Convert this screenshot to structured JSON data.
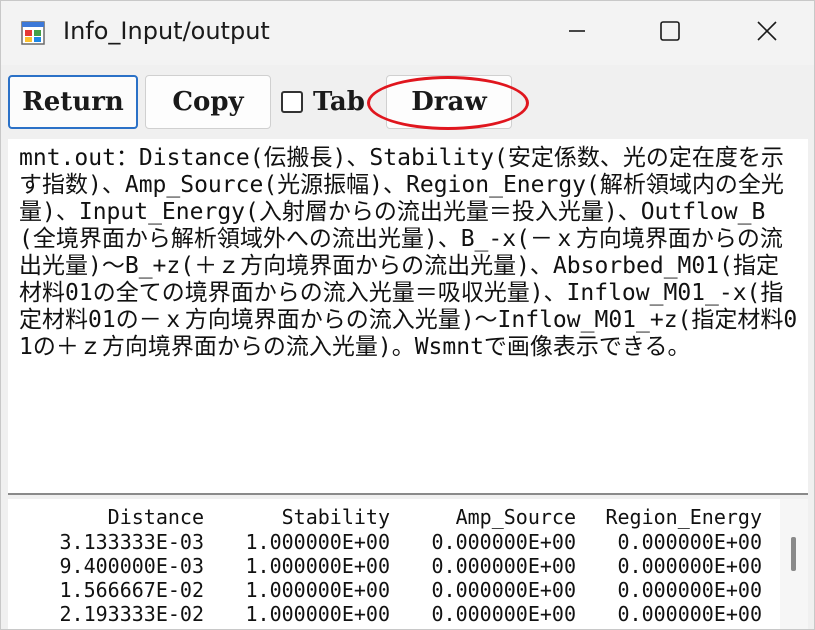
{
  "window": {
    "title": "Info_Input/output",
    "icon": "app-window-icon"
  },
  "titlebar_buttons": {
    "minimize": "minimize-icon",
    "maximize": "maximize-icon",
    "close": "close-icon"
  },
  "toolbar": {
    "return_label": "Return",
    "copy_label": "Copy",
    "tab_label": "Tab",
    "tab_checked": false,
    "draw_label": "Draw"
  },
  "colors": {
    "focus_border": "#2b71c7",
    "annotation": "#e0161e"
  },
  "description": "mnt.out：Distance(伝搬長)、Stability(安定係数、光の定在度を示す指数)、Amp_Source(光源振幅)、Region_Energy(解析領域内の全光量)、Input_Energy(入射層からの流出光量＝投入光量)、Outflow_B(全境界面から解析領域外への流出光量)、B_-x(－ｘ方向境界面からの流出光量)～B_+z(＋ｚ方向境界面からの流出光量)、Absorbed_M01(指定材料01の全ての境界面からの流入光量＝吸収光量)、Inflow_M01_-x(指定材料01の－ｘ方向境界面からの流入光量)～Inflow_M01_+z(指定材料01の＋ｚ方向境界面からの流入光量)。Wsmntで画像表示できる。",
  "table": {
    "headers": [
      "Distance",
      "Stability",
      "Amp_Source",
      "Region_Energy"
    ],
    "rows": [
      [
        "3.133333E-03",
        "1.000000E+00",
        "0.000000E+00",
        "0.000000E+00"
      ],
      [
        "9.400000E-03",
        "1.000000E+00",
        "0.000000E+00",
        "0.000000E+00"
      ],
      [
        "1.566667E-02",
        "1.000000E+00",
        "0.000000E+00",
        "0.000000E+00"
      ],
      [
        "2.193333E-02",
        "1.000000E+00",
        "0.000000E+00",
        "0.000000E+00"
      ]
    ]
  }
}
